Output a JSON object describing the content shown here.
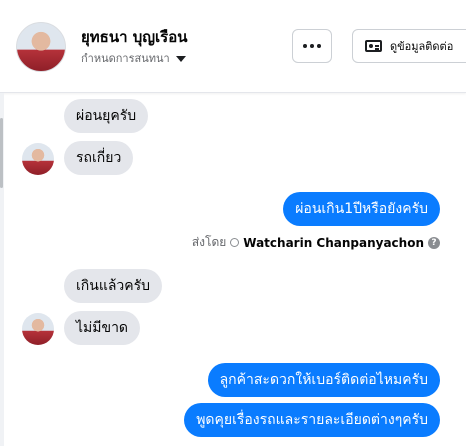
{
  "header": {
    "contact_name": "ยุทธนา บุญเรือน",
    "subtitle": "กำหนดการสนทนา",
    "more_label": "...",
    "contact_info_label": "ดูข้อมูลติดต่อ"
  },
  "messages": [
    {
      "text": "ผ่อนยุครับ",
      "direction": "incoming"
    },
    {
      "text": "รถเกี่ยว",
      "direction": "incoming"
    },
    {
      "text": "ผ่อนเกิน1ปีหรือยังครับ",
      "direction": "outgoing"
    },
    {
      "text": "เกินแล้วครับ",
      "direction": "incoming"
    },
    {
      "text": "ไม่มีขาด",
      "direction": "incoming"
    },
    {
      "text": "ลูกค้าสะดวกให้เบอร์ติดต่อไหมครับ",
      "direction": "outgoing"
    },
    {
      "text": "พูดคุยเรื่องรถและรายละเอียดต่างๆครับ",
      "direction": "outgoing"
    }
  ],
  "sent_by": {
    "prefix": "ส่งโดย",
    "name": "Watcharin Chanpanyachon",
    "help": "?"
  },
  "colors": {
    "outgoing_bubble": "#0a7cff",
    "incoming_bubble": "#e4e6eb"
  },
  "icons": [
    "more-dots-icon",
    "contact-card-icon",
    "chevron-down-icon",
    "sent-by-icon",
    "help-icon"
  ]
}
